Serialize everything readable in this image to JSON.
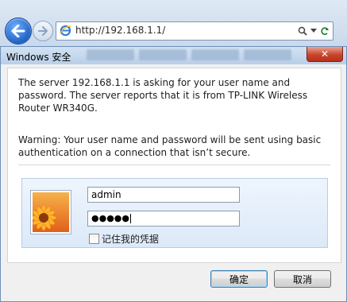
{
  "browser": {
    "address_url": "http://192.168.1.1/",
    "search_glyph": "⌕",
    "dropdown_glyph": "▾",
    "refresh_glyph": "↻"
  },
  "dialog": {
    "title": "Windows 安全",
    "close_glyph": "✕",
    "message": "The server 192.168.1.1 is asking for your user name and password. The server reports that it is from TP-LINK Wireless Router WR340G.",
    "warning": "Warning: Your user name and password will be sent using basic authentication on a connection that isn’t secure.",
    "username_value": "admin",
    "password_mask": "●●●●●",
    "remember_label": "记住我的凭据",
    "ok_label": "确定",
    "cancel_label": "取消"
  },
  "colors": {
    "accent": "#1f62c4",
    "close_red": "#c8452d",
    "panel_blue": "#dce9f8"
  }
}
